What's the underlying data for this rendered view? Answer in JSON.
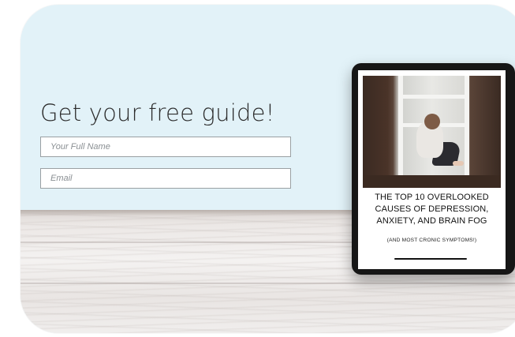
{
  "form": {
    "headline": "Get your free guide!",
    "name_placeholder": "Your Full Name",
    "email_placeholder": "Email"
  },
  "guide": {
    "title_line1": "THE TOP 10 OVERLOOKED",
    "title_line2": "CAUSES OF DEPRESSION,",
    "title_line3": "ANXIETY, AND BRAIN FOG",
    "subtitle": "(AND MOST CRONIC SYMPTOMS!)"
  },
  "colors": {
    "card_background": "#e2f2f8",
    "tablet_frame": "#161616",
    "text": "#2b2b2b",
    "input_border": "#9aa0a3"
  }
}
